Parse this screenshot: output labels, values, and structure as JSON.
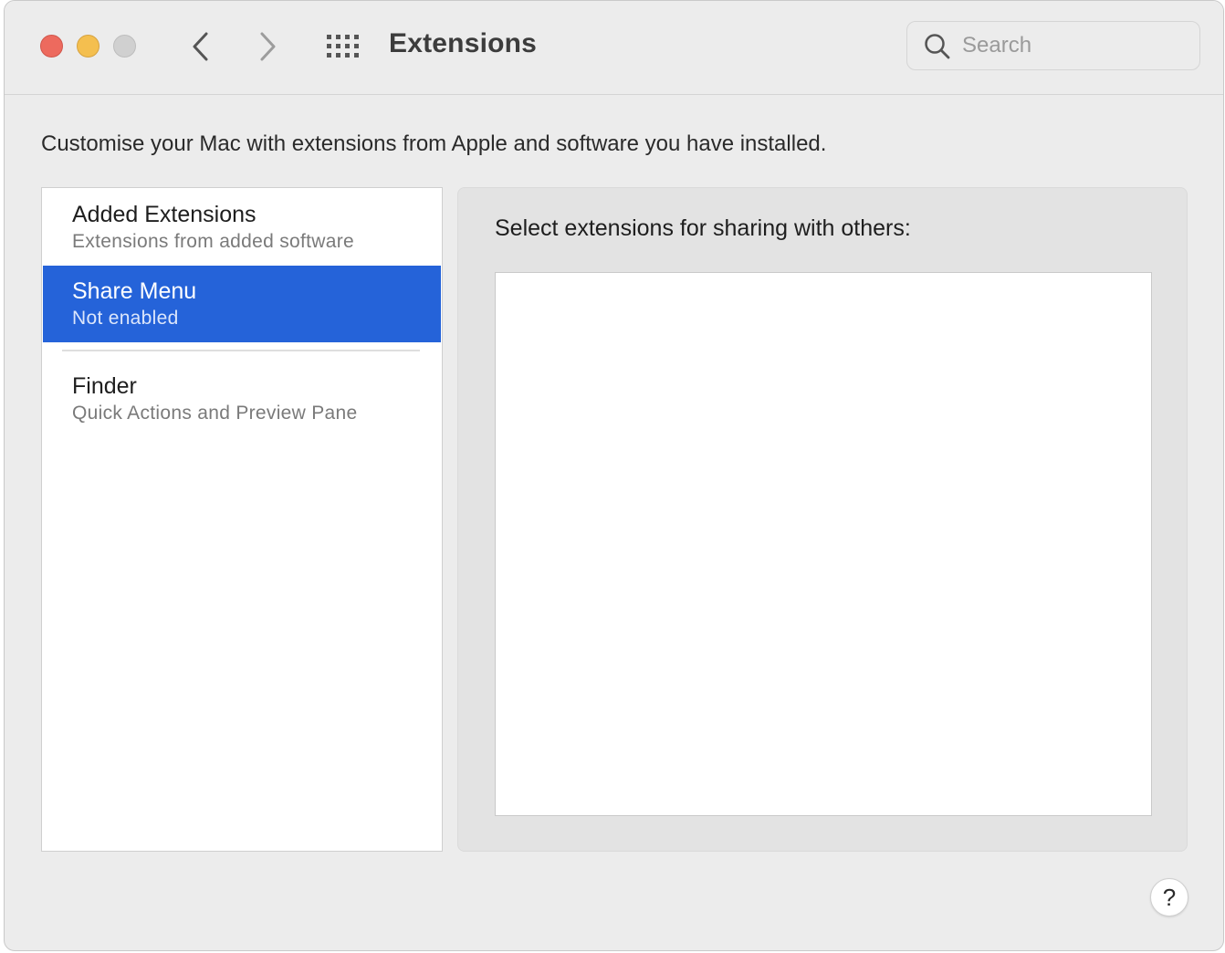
{
  "window": {
    "title": "Extensions",
    "traffic_lights": {
      "close_color": "#ed6a5e",
      "minimize_color": "#f4bf4f",
      "zoom_color": "#d0d0d0"
    }
  },
  "toolbar": {
    "back_icon": "chevron-left-icon",
    "forward_icon": "chevron-right-icon",
    "show_all_icon": "grid-icon",
    "search_placeholder": "Search",
    "search_value": ""
  },
  "main": {
    "description": "Customise your Mac with extensions from Apple and software you have installed."
  },
  "sidebar": {
    "items": [
      {
        "title": "Added Extensions",
        "subtitle": "Extensions from added software",
        "selected": false
      },
      {
        "title": "Share Menu",
        "subtitle": "Not enabled",
        "selected": true
      },
      {
        "title": "Finder",
        "subtitle": "Quick Actions and Preview Pane",
        "selected": false
      }
    ],
    "selection_color": "#2563d9"
  },
  "detail": {
    "heading": "Select extensions for sharing with others:",
    "items": []
  },
  "footer": {
    "help_label": "?"
  }
}
